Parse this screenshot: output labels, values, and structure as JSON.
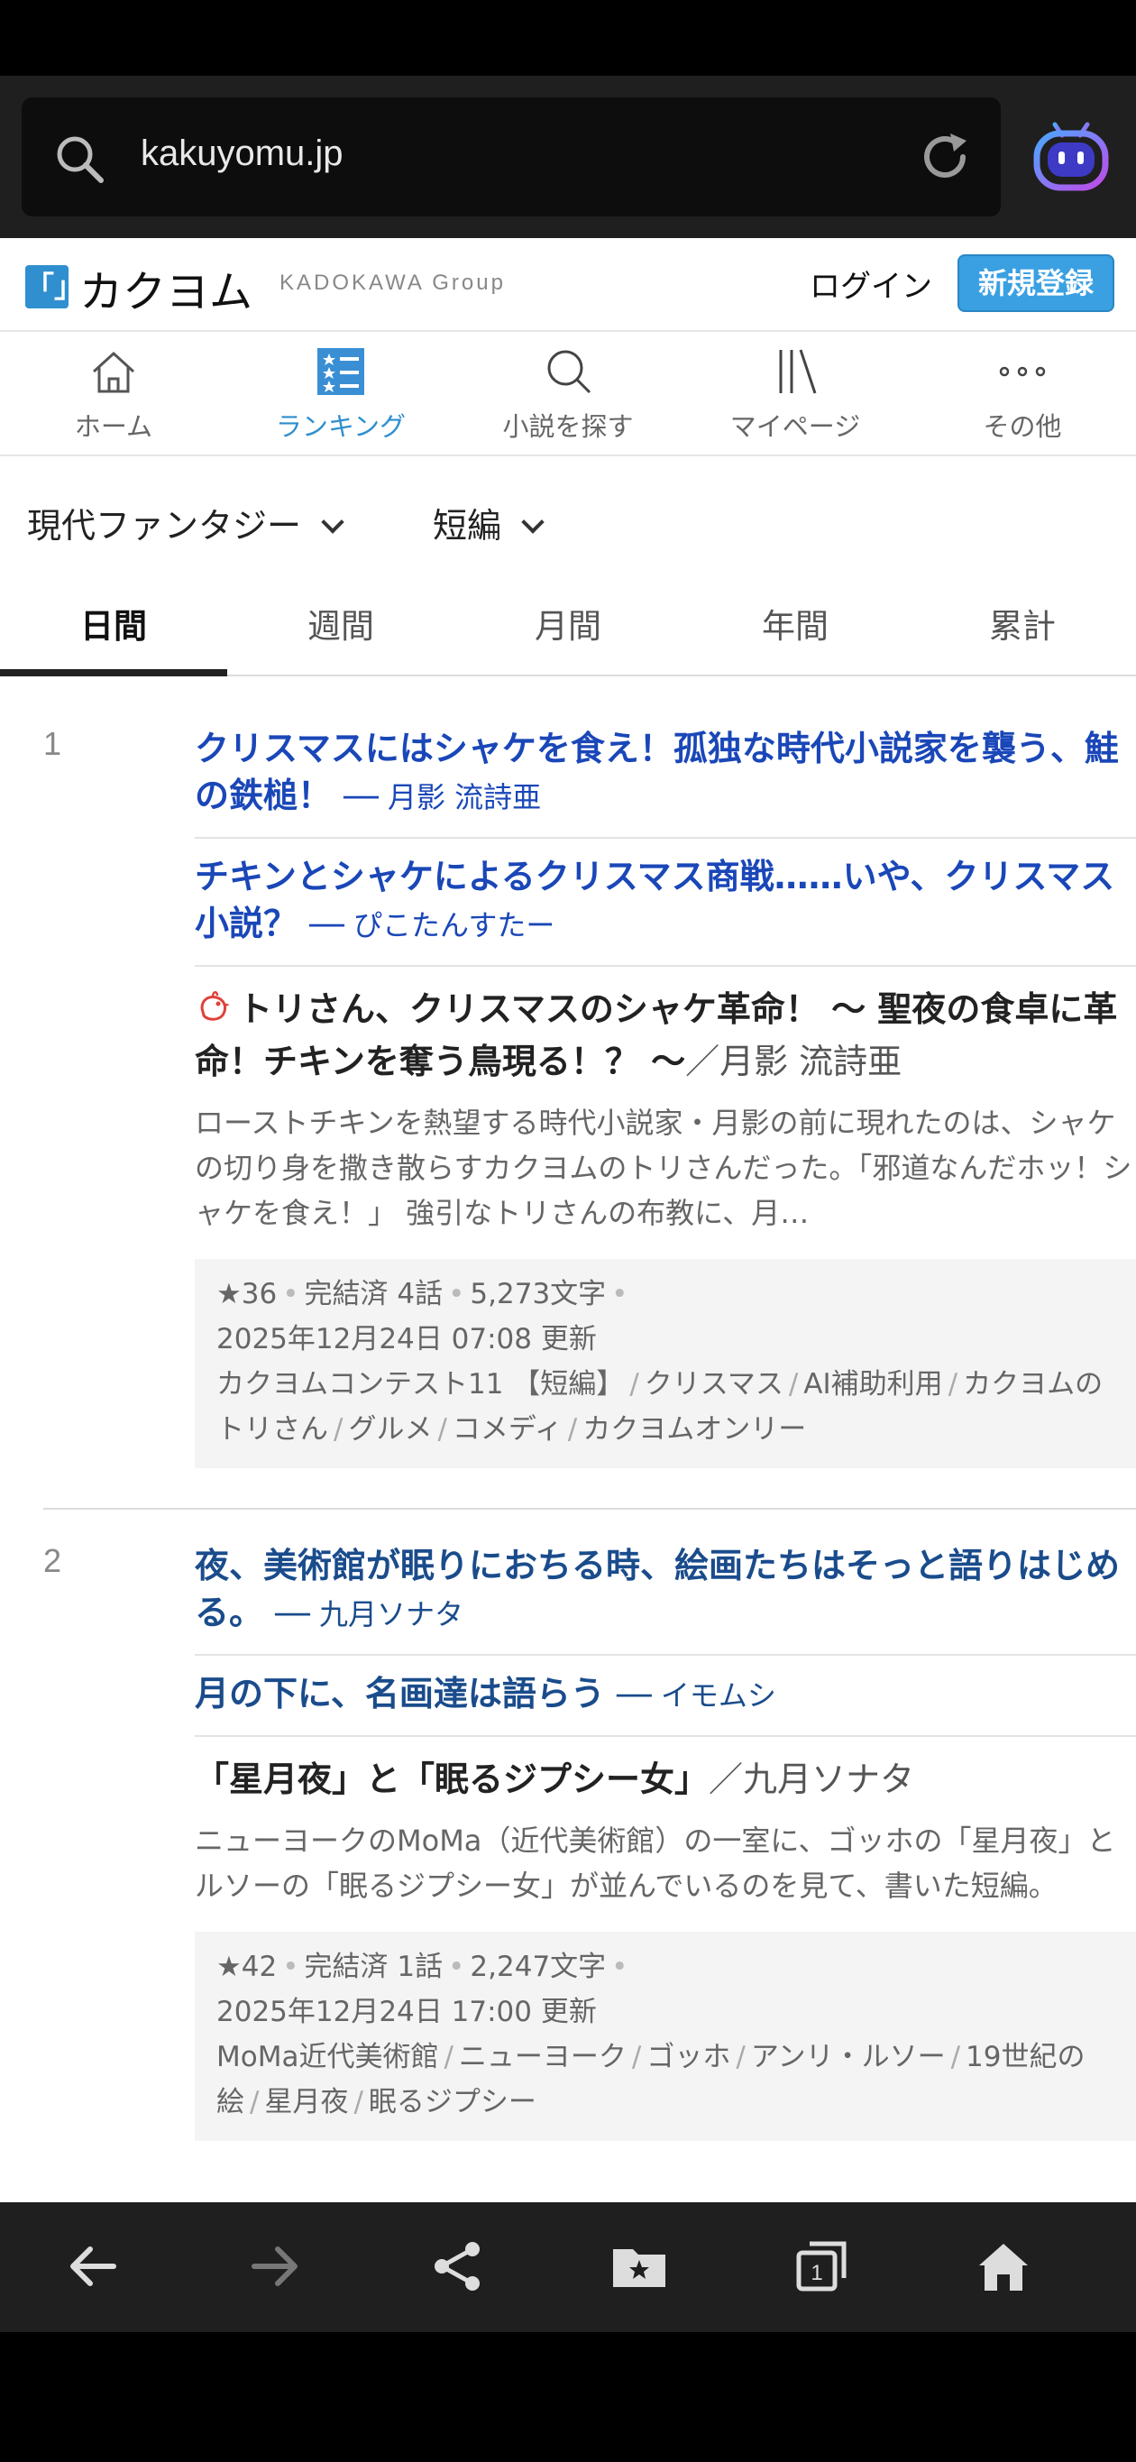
{
  "browser": {
    "url": "kakuyomu.jp"
  },
  "header": {
    "logo_mark": "「」",
    "logo_text": "カクヨム",
    "logo_sub": "KADOKAWA Group",
    "login": "ログイン",
    "signup": "新規登録"
  },
  "nav": [
    {
      "label": "ホーム",
      "icon": "home-icon"
    },
    {
      "label": "ランキング",
      "icon": "ranking-icon",
      "active": true
    },
    {
      "label": "小説を探す",
      "icon": "search-icon"
    },
    {
      "label": "マイページ",
      "icon": "mypage-icon"
    },
    {
      "label": "その他",
      "icon": "more-icon"
    }
  ],
  "filters": {
    "genre": "現代ファンタジー",
    "length": "短編"
  },
  "period_tabs": [
    "日間",
    "週間",
    "月間",
    "年間",
    "累計"
  ],
  "entries": [
    {
      "rank": "1",
      "reviews": [
        {
          "title": "クリスマスにはシャケを食え！孤独な時代小説家を襲う、鮭の鉄槌！",
          "by": "── 月影 流詩亜"
        },
        {
          "title": "チキンとシャケによるクリスマス商戦……いや、クリスマス小説？",
          "by": "── ぴこたんすたー"
        }
      ],
      "work_title": "トリさん、クリスマスのシャケ革命！ 〜 聖夜の食卓に革命！チキンを奪う鳥現る！？ 〜",
      "author": "／月影 流詩亜",
      "catch": "ローストチキンを熱望する時代小説家・月影の前に現れたのは、シャケの切り身を撒き散らすカクヨムのトリさんだった。「邪道なんだホッ！シャケを食え！」 強引なトリさんの布教に、月…",
      "stars": "★36",
      "status": "完結済 4話",
      "chars": "5,273文字",
      "updated": "2025年12月24日 07:08 更新",
      "tags": [
        "カクヨムコンテスト11 【短編】",
        "クリスマス",
        "AI補助利用",
        "カクヨムのトリさん",
        "グルメ",
        "コメディ",
        "カクヨムオンリー"
      ]
    },
    {
      "rank": "2",
      "reviews": [
        {
          "title": "夜、美術館が眠りにおちる時、絵画たちはそっと語りはじめる。",
          "by": "── 九月ソナタ"
        },
        {
          "title": "月の下に、名画達は語らう",
          "by": "── イモムシ"
        }
      ],
      "work_title": "「星月夜」と「眠るジプシー女」",
      "author": "／九月ソナタ",
      "catch": "ニューヨークのMoMa（近代美術館）の一室に、ゴッホの「星月夜」とルソーの「眠るジプシー女」が並んでいるのを見て、書いた短編。",
      "stars": "★42",
      "status": "完結済 1話",
      "chars": "2,247文字",
      "updated": "2025年12月24日 17:00 更新",
      "tags": [
        "MoMa近代美術館",
        "ニューヨーク",
        "ゴッホ",
        "アンリ・ルソー",
        "19世紀の絵",
        "星月夜",
        "眠るジプシー"
      ]
    }
  ],
  "bottom_bar": {
    "tab_count": "1"
  }
}
